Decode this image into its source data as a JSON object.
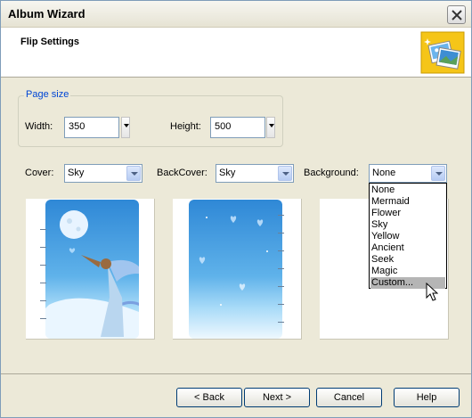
{
  "window": {
    "title": "Album Wizard"
  },
  "header": {
    "title": "Flip Settings",
    "icon": "photo-album-icon"
  },
  "page_size": {
    "legend": "Page size",
    "width_label": "Width:",
    "width_value": "350",
    "height_label": "Height:",
    "height_value": "500"
  },
  "selectors": {
    "cover_label": "Cover:",
    "cover_value": "Sky",
    "backcover_label": "BackCover:",
    "backcover_value": "Sky",
    "background_label": "Background:",
    "background_value": "None"
  },
  "background_options": [
    "None",
    "Mermaid",
    "Flower",
    "Sky",
    "Yellow",
    "Ancient",
    "Seek",
    "Magic",
    "Custom..."
  ],
  "background_highlighted": "Custom...",
  "buttons": {
    "back": "< Back",
    "next": "Next >",
    "cancel": "Cancel",
    "help": "Help"
  },
  "colors": {
    "legend": "#0046d5",
    "sky_top": "#2f88d6",
    "sky_bottom": "#eef8ff",
    "selection": "#b5b5b5"
  }
}
